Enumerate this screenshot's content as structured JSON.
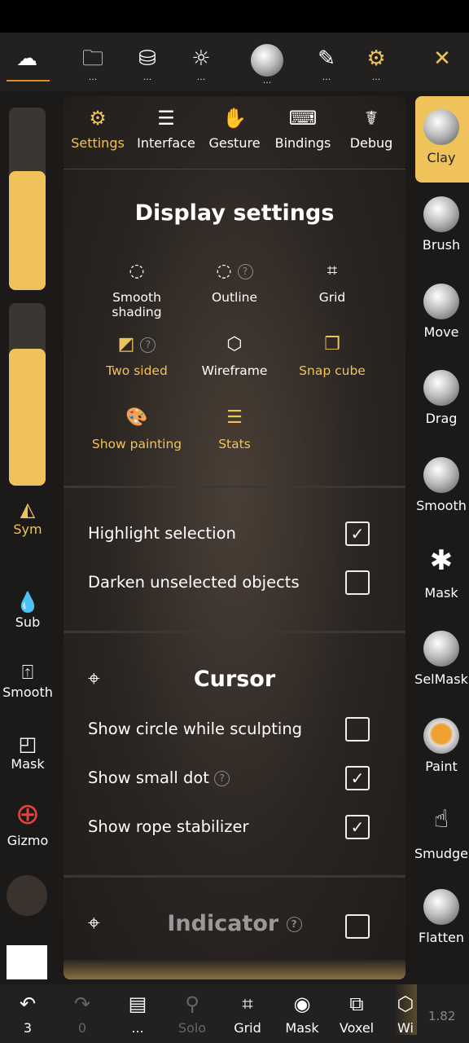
{
  "colors": {
    "accent": "#f0c35a",
    "background": "#1b1a19"
  },
  "topbar": {
    "items": [
      {
        "icon": "sculpt-logo-icon",
        "glyph": "☁"
      },
      {
        "icon": "folder-icon",
        "glyph": "🗀",
        "dots": "..."
      },
      {
        "icon": "gold-bars-icon",
        "glyph": "⛁",
        "dots": "..."
      },
      {
        "icon": "sun-icon",
        "glyph": "☼",
        "dots": "..."
      },
      {
        "icon": "material-sphere-icon",
        "dots": "..."
      },
      {
        "icon": "paintbrush-icon",
        "glyph": "✎",
        "dots": "..."
      },
      {
        "icon": "settings-gear-icon",
        "glyph": "⚙",
        "dots": "..."
      },
      {
        "icon": "tools-icon",
        "glyph": "✕"
      }
    ]
  },
  "tabs": [
    {
      "label": "Settings",
      "glyph": "⚙",
      "active": true
    },
    {
      "label": "Interface",
      "glyph": "☰"
    },
    {
      "label": "Gesture",
      "glyph": "✋"
    },
    {
      "label": "Bindings",
      "glyph": "⌨"
    },
    {
      "label": "Debug",
      "glyph": "☤"
    }
  ],
  "display": {
    "title": "Display settings",
    "options": [
      {
        "label": "Smooth shading",
        "glyph": "◌",
        "active": false
      },
      {
        "label": "Outline",
        "glyph": "◌",
        "active": false,
        "help": "?"
      },
      {
        "label": "Grid",
        "glyph": "⌗",
        "active": false
      },
      {
        "label": "Two sided",
        "glyph": "◩",
        "active": true,
        "help": "?"
      },
      {
        "label": "Wireframe",
        "glyph": "⬡",
        "active": false
      },
      {
        "label": "Snap cube",
        "glyph": "❒",
        "active": true
      },
      {
        "label": "Show painting",
        "glyph": "🎨",
        "active": true
      },
      {
        "label": "Stats",
        "glyph": "☰",
        "active": true
      }
    ],
    "checks": [
      {
        "label": "Highlight selection",
        "checked": true
      },
      {
        "label": "Darken unselected objects",
        "checked": false
      }
    ]
  },
  "cursor": {
    "title": "Cursor",
    "checks": [
      {
        "label": "Show circle while sculpting",
        "checked": false
      },
      {
        "label": "Show small dot",
        "checked": true,
        "help": "?"
      },
      {
        "label": "Show rope stabilizer",
        "checked": true
      }
    ]
  },
  "indicator": {
    "title": "Indicator",
    "help": "?",
    "checked": false
  },
  "left": {
    "sliders": [
      {
        "value": 0.65
      },
      {
        "value": 0.75
      }
    ],
    "sym": "Sym",
    "sub": "Sub",
    "smooth": "Smooth",
    "mask": "Mask",
    "gizmo": "Gizmo"
  },
  "tools": [
    "Clay",
    "Brush",
    "Move",
    "Drag",
    "Smooth",
    "Mask",
    "SelMask",
    "Paint",
    "Smudge",
    "Flatten"
  ],
  "active_tool": "Clay",
  "bottombar": {
    "undo": "3",
    "redo": "0",
    "more": "...",
    "solo": "Solo",
    "grid": "Grid",
    "mask": "Mask",
    "voxel": "Voxel",
    "wire": "Wi",
    "version": "1.82"
  }
}
